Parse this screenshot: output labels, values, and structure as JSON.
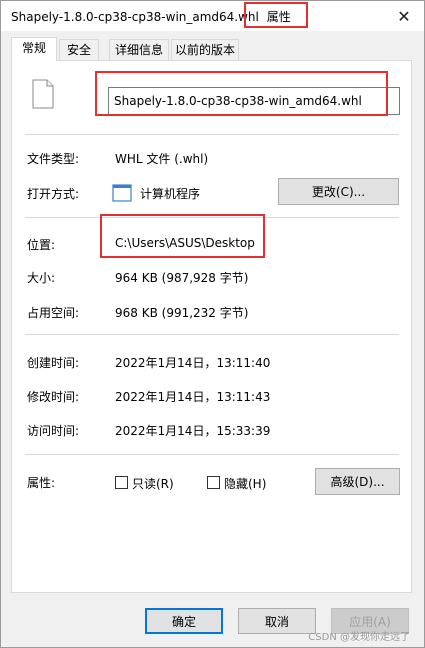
{
  "window": {
    "title": "Shapely-1.8.0-cp38-cp38-win_amd64.whl",
    "title_suffix": "属性",
    "close_symbol": "✕"
  },
  "tabs": [
    {
      "label": "常规",
      "active": true
    },
    {
      "label": "安全",
      "active": false
    },
    {
      "label": "详细信息",
      "active": false
    },
    {
      "label": "以前的版本",
      "active": false
    }
  ],
  "general": {
    "file_name": "Shapely-1.8.0-cp38-cp38-win_amd64.whl",
    "file_type_label": "文件类型:",
    "file_type_value": "WHL 文件 (.whl)",
    "open_with_label": "打开方式:",
    "open_with_value": "计算机程序",
    "change_button": "更改(C)...",
    "location_label": "位置:",
    "location_value": "C:\\Users\\ASUS\\Desktop",
    "size_label": "大小:",
    "size_value": "964 KB (987,928 字节)",
    "size_on_disk_label": "占用空间:",
    "size_on_disk_value": "968 KB (991,232 字节)",
    "created_label": "创建时间:",
    "created_value": "2022年1月14日，13:11:40",
    "modified_label": "修改时间:",
    "modified_value": "2022年1月14日，13:11:43",
    "accessed_label": "访问时间:",
    "accessed_value": "2022年1月14日，15:33:39",
    "attributes_label": "属性:",
    "readonly_label": "只读(R)",
    "hidden_label": "隐藏(H)",
    "advanced_button": "高级(D)..."
  },
  "footer": {
    "ok_button": "确定",
    "cancel_button": "取消",
    "apply_button": "应用(A)"
  },
  "watermark": "CSDN @发现你走远了",
  "colors": {
    "highlight_box": "#e03030",
    "primary_border": "#0078d7"
  }
}
